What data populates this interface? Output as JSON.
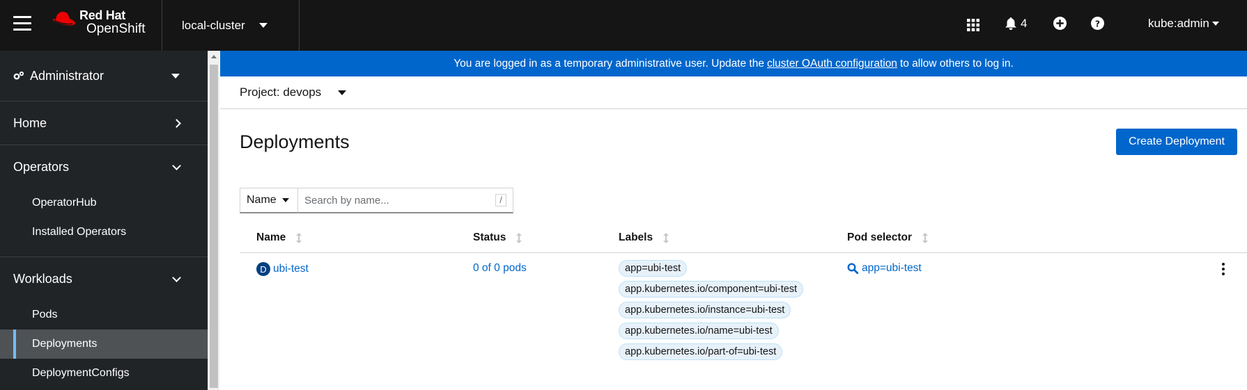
{
  "masthead": {
    "brand_line1": "Red Hat",
    "brand_line2": "OpenShift",
    "cluster": "local-cluster",
    "notification_count": "4",
    "user": "kube:admin",
    "icons": [
      "hamburger-icon",
      "app-launcher-icon",
      "bell-icon",
      "plus-circle-icon",
      "help-icon"
    ]
  },
  "sidebar": {
    "perspective": "Administrator",
    "groups": [
      {
        "label": "Home",
        "expanded": false
      },
      {
        "label": "Operators",
        "expanded": true,
        "items": [
          "OperatorHub",
          "Installed Operators"
        ]
      },
      {
        "label": "Workloads",
        "expanded": true,
        "items": [
          "Pods",
          "Deployments",
          "DeploymentConfigs"
        ],
        "active": "Deployments"
      }
    ]
  },
  "banner": {
    "before": "You are logged in as a temporary administrative user. Update the",
    "link": "cluster OAuth configuration",
    "after": "to allow others to log in."
  },
  "project": {
    "label": "Project: devops"
  },
  "page": {
    "title": "Deployments",
    "create_button": "Create Deployment"
  },
  "filter": {
    "type": "Name",
    "placeholder": "Search by name...",
    "shortcut": "/"
  },
  "table": {
    "columns": [
      "Name",
      "Status",
      "Labels",
      "Pod selector"
    ],
    "rows": [
      {
        "badge": "D",
        "name": "ubi-test",
        "status": "0 of 0 pods",
        "labels": [
          "app=ubi-test",
          "app.kubernetes.io/component=ubi-test",
          "app.kubernetes.io/instance=ubi-test",
          "app.kubernetes.io/name=ubi-test",
          "app.kubernetes.io/part-of=ubi-test"
        ],
        "pod_selector": "app=ubi-test"
      }
    ]
  },
  "colors": {
    "masthead": "#151515",
    "sidebar": "#212427",
    "accent": "#0066cc",
    "active_nav": "#4f5255",
    "active_indicator": "#73bcf7"
  }
}
